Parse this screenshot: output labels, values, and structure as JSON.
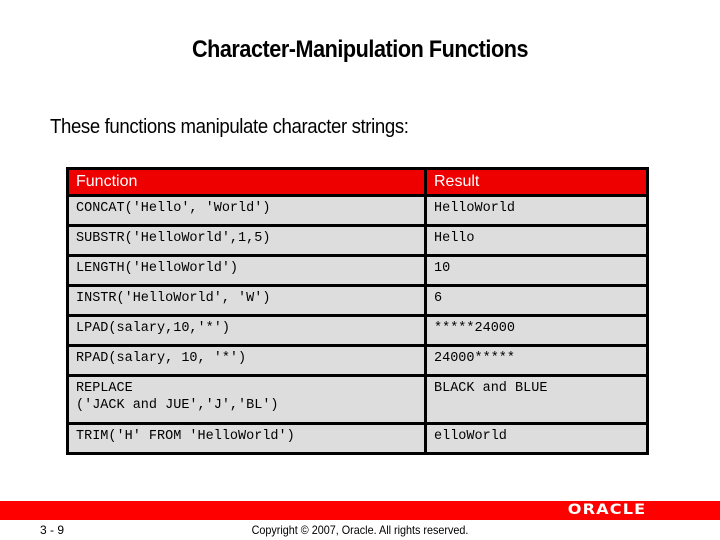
{
  "slide": {
    "title": "Character-Manipulation Functions",
    "intro": "These functions manipulate character strings:"
  },
  "table": {
    "headers": [
      "Function",
      "Result"
    ],
    "rows": [
      {
        "function": "CONCAT('Hello', 'World')",
        "result": "HelloWorld"
      },
      {
        "function": "SUBSTR('HelloWorld',1,5)",
        "result": "Hello"
      },
      {
        "function": "LENGTH('HelloWorld')",
        "result": "10"
      },
      {
        "function": "INSTR('HelloWorld', 'W')",
        "result": "6"
      },
      {
        "function": "LPAD(salary,10,'*')",
        "result": "*****24000"
      },
      {
        "function": "RPAD(salary, 10, '*')",
        "result": "24000*****"
      },
      {
        "function_line1": "REPLACE",
        "function_line2": "('JACK and JUE','J','BL')",
        "result": "BLACK and BLUE"
      },
      {
        "function": "TRIM('H' FROM 'HelloWorld')",
        "result": "elloWorld"
      }
    ]
  },
  "footer": {
    "page_number": "3 - 9",
    "copyright": "Copyright © 2007, Oracle. All rights reserved.",
    "logo_text": "ORACLE",
    "brand_color": "#ff0000"
  }
}
